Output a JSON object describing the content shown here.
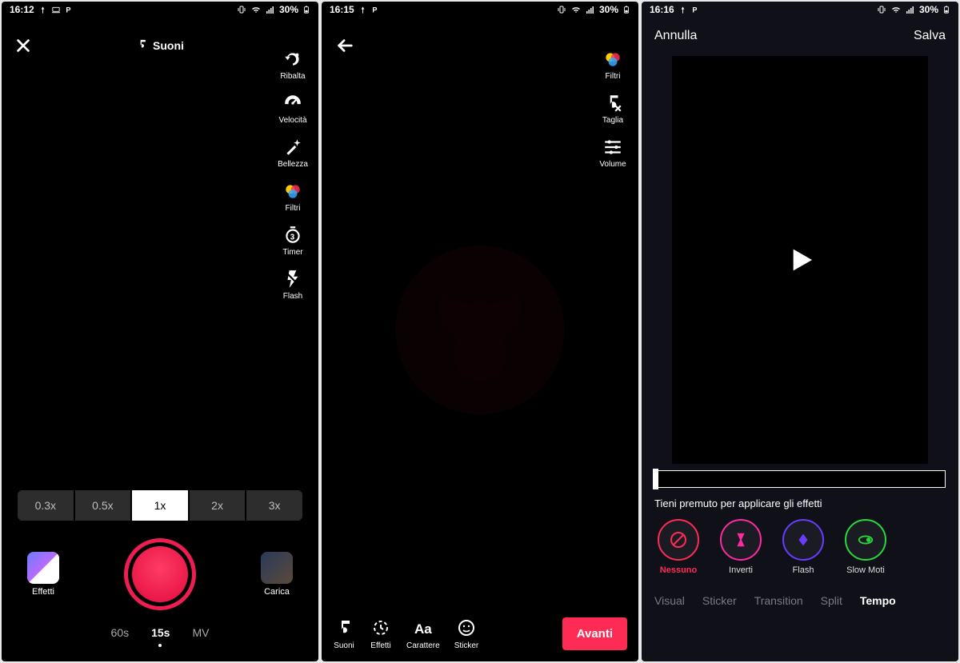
{
  "phone1": {
    "status": {
      "time": "16:12",
      "battery": "30%"
    },
    "sounds_label": "Suoni",
    "tools": {
      "flip": "Ribalta",
      "speed": "Velocità",
      "beauty": "Bellezza",
      "filters": "Filtri",
      "timer": "Timer",
      "flash": "Flash"
    },
    "speeds": {
      "s0": "0.3x",
      "s1": "0.5x",
      "s2": "1x",
      "s3": "2x",
      "s4": "3x"
    },
    "effects_label": "Effetti",
    "upload_label": "Carica",
    "modes": {
      "m0": "60s",
      "m1": "15s",
      "m2": "MV"
    }
  },
  "phone2": {
    "status": {
      "time": "16:15",
      "battery": "30%"
    },
    "tools": {
      "filters": "Filtri",
      "cut": "Taglia",
      "volume": "Volume"
    },
    "bottom": {
      "sounds": "Suoni",
      "effects": "Effetti",
      "text": "Carattere",
      "sticker": "Sticker"
    },
    "next": "Avanti"
  },
  "phone3": {
    "status": {
      "time": "16:16",
      "battery": "30%"
    },
    "cancel": "Annulla",
    "save": "Salva",
    "hint": "Tieni premuto per applicare gli effetti",
    "effects": {
      "none": "Nessuno",
      "invert": "Inverti",
      "flash": "Flash",
      "slow": "Slow Moti"
    },
    "tabs": {
      "visual": "Visual",
      "sticker": "Sticker",
      "transition": "Transition",
      "split": "Split",
      "tempo": "Tempo"
    }
  }
}
